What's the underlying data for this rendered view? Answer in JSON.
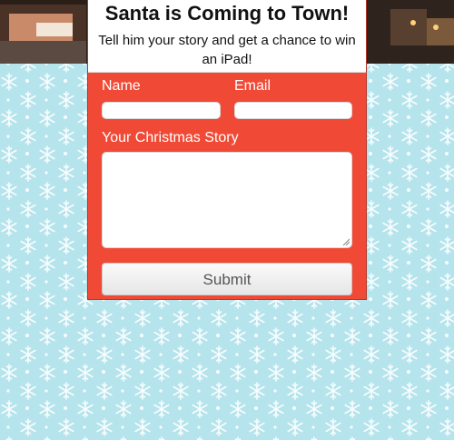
{
  "header": {
    "title": "Santa is Coming to Town!",
    "subtitle": "Tell him your story and get a chance to win an iPad!"
  },
  "form": {
    "name_label": "Name",
    "name_value": "",
    "email_label": "Email",
    "email_value": "",
    "story_label": "Your Christmas Story",
    "story_value": "",
    "submit_label": "Submit"
  },
  "colors": {
    "card_red": "#f04a37",
    "background_blue": "#b5e4ec",
    "snowflake": "#ffffff"
  },
  "icons": [
    "snowflake-icon",
    "resize-grip-icon"
  ]
}
